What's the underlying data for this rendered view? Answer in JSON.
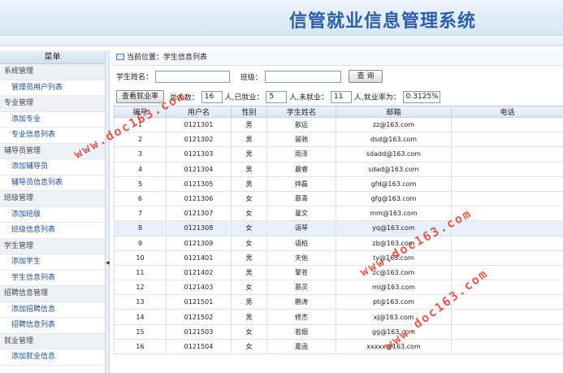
{
  "app_title": "信管就业信息管理系统",
  "sidebar": {
    "menu_label": "菜单",
    "groups": [
      {
        "title": "系统管理",
        "items": [
          "管理员用户列表"
        ]
      },
      {
        "title": "专业管理",
        "items": [
          "添加专业",
          "专业信息列表"
        ]
      },
      {
        "title": "辅导员管理",
        "items": [
          "添加辅导员",
          "辅导员信息列表"
        ]
      },
      {
        "title": "班级管理",
        "items": [
          "添加班级",
          "班级信息列表"
        ]
      },
      {
        "title": "学生管理",
        "items": [
          "添加学生",
          "学生信息列表"
        ]
      },
      {
        "title": "招聘信息管理",
        "items": [
          "添加招聘信息",
          "招聘信息列表"
        ]
      },
      {
        "title": "就业管理",
        "items": [
          "添加就业信息"
        ]
      }
    ]
  },
  "breadcrumb": "当前位置：学生信息列表",
  "search": {
    "name_label": "学生姓名：",
    "name_value": "",
    "class_label": "班级：",
    "class_value": "",
    "button": "查 询"
  },
  "stats": {
    "button": "查看就业率",
    "total_label": "总人数：",
    "total": "16",
    "employed_label": "人,已就业：",
    "employed": "5",
    "unemployed_label": "人,未就业：",
    "unemployed": "11",
    "rate_label": "人,就业率为：",
    "rate": "0.3125%"
  },
  "table": {
    "headers": [
      "编号",
      "用户名",
      "性别",
      "学生姓名",
      "邮箱",
      "电话"
    ],
    "rows": [
      [
        "1",
        "0121301",
        "男",
        "歆远",
        "zz@163.com",
        ""
      ],
      [
        "2",
        "0121302",
        "男",
        "骏驰",
        "dsd@163.com",
        ""
      ],
      [
        "3",
        "0121303",
        "男",
        "雨泽",
        "sdadd@163.com",
        ""
      ],
      [
        "4",
        "0121304",
        "男",
        "晨睿",
        "sdad@163.com",
        ""
      ],
      [
        "5",
        "0121305",
        "男",
        "烨磊",
        "gfd@163.com",
        ""
      ],
      [
        "6",
        "0121306",
        "女",
        "慕青",
        "gfg@163.com",
        ""
      ],
      [
        "7",
        "0121307",
        "女",
        "曼文",
        "mm@163.com",
        ""
      ],
      [
        "8",
        "0121308",
        "女",
        "语琴",
        "yq@163.com",
        ""
      ],
      [
        "9",
        "0121309",
        "女",
        "语柏",
        "zb@163.com",
        ""
      ],
      [
        "10",
        "0121401",
        "男",
        "天佑",
        "ty@163.com",
        ""
      ],
      [
        "11",
        "0121402",
        "男",
        "擎苍",
        "zc@163.com",
        ""
      ],
      [
        "12",
        "0121403",
        "女",
        "慕灵",
        "ml@163.com",
        ""
      ],
      [
        "13",
        "0121501",
        "男",
        "鹏涛",
        "pt@163.com",
        ""
      ],
      [
        "14",
        "0121502",
        "男",
        "修杰",
        "xj@163.com",
        ""
      ],
      [
        "15",
        "0121503",
        "女",
        "若烟",
        "gg@163.com",
        ""
      ],
      [
        "16",
        "0121504",
        "女",
        "夏函",
        "xxxxx@163.com",
        ""
      ]
    ]
  },
  "watermark": "www.doc163.com"
}
